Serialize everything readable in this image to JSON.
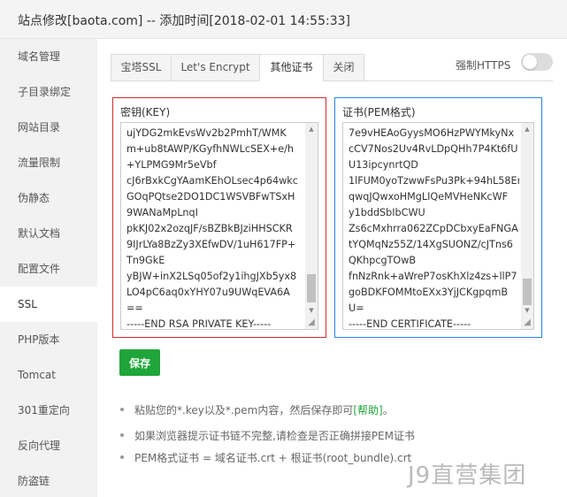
{
  "window": {
    "title": "站点修改[baota.com] -- 添加时间[2018-02-01 14:55:33]"
  },
  "sidebar": {
    "items": [
      {
        "label": "域名管理"
      },
      {
        "label": "子目录绑定"
      },
      {
        "label": "网站目录"
      },
      {
        "label": "流量限制"
      },
      {
        "label": "伪静态"
      },
      {
        "label": "默认文档"
      },
      {
        "label": "配置文件"
      },
      {
        "label": "SSL",
        "active": true
      },
      {
        "label": "PHP版本"
      },
      {
        "label": "Tomcat"
      },
      {
        "label": "301重定向"
      },
      {
        "label": "反向代理"
      },
      {
        "label": "防盗链"
      }
    ]
  },
  "tabs": [
    {
      "label": "宝塔SSL"
    },
    {
      "label": "Let's Encrypt"
    },
    {
      "label": "其他证书",
      "active": true
    },
    {
      "label": "关闭"
    }
  ],
  "force_https": {
    "label": "强制HTTPS",
    "enabled": false
  },
  "key_panel": {
    "title": "密钥(KEY)",
    "lines": [
      "ujYDG2mkEvsWv2b2PmhT/WMK",
      "m+ub8tAWP/KGyfhNWLcSEX+e/h",
      "+YLPMG9Mr5eVbf",
      "cJ6rBxkCgYAamKEhOLsec4p64wkc",
      "GOqPQtse2DO1DC1WSVBFwTSxH",
      "9WANaMpLnqI",
      "pkKJ02x2ozqJF/sBZBkBJziHHSCKR",
      "9IJrLYa8BzZy3XEfwDV/1uH617FP+",
      "Tn9GkE",
      "yBJW+inX2LSq05of2y1ihgJXb5yx8",
      "LO4pC6aq0xYHY07u9UWqEVA6A",
      "==",
      "-----END RSA PRIVATE KEY-----"
    ]
  },
  "cert_panel": {
    "title": "证书(PEM格式)",
    "lines": [
      "7e9vHEAoGyysMO6HzPWYMkyNx",
      "cCV7Nos2Uv4RvLDpQHh7P4Kt6fU",
      "U13ipcynrtQD",
      "1lFUM0yoTzwwFsPu3Pk+94hL58Er",
      "qwqJQwxoHMgLIQeMVHeNKcWF",
      "y1bddSbIbCWU",
      "Zs6cMxhrra062ZCpDCbxyEaFNGA",
      "tYQMqNz55Z/14XgSUONZ/cJTns6",
      "QKhpcgTOwB",
      "fnNzRnk+aWreP7osKhXlz4zs+llP7",
      "goBDKFOMMtoEXx3YjJCKgpqmB",
      "U=",
      "-----END CERTIFICATE-----"
    ]
  },
  "save_button": {
    "label": "保存"
  },
  "notes": [
    {
      "text": "粘贴您的*.key以及*.pem内容，然后保存即可",
      "link": "[帮助]",
      "suffix": "。"
    },
    {
      "text": "如果浏览器提示证书链不完整,请检查是否正确拼接PEM证书"
    },
    {
      "text": "PEM格式证书 = 域名证书.crt + 根证书(root_bundle).crt"
    }
  ],
  "watermark": "J9直营集团",
  "colors": {
    "accent": "#20a53a",
    "key_border": "#c9302c",
    "cert_border": "#2e86de",
    "sidebar_bg": "#f2f2f2"
  }
}
